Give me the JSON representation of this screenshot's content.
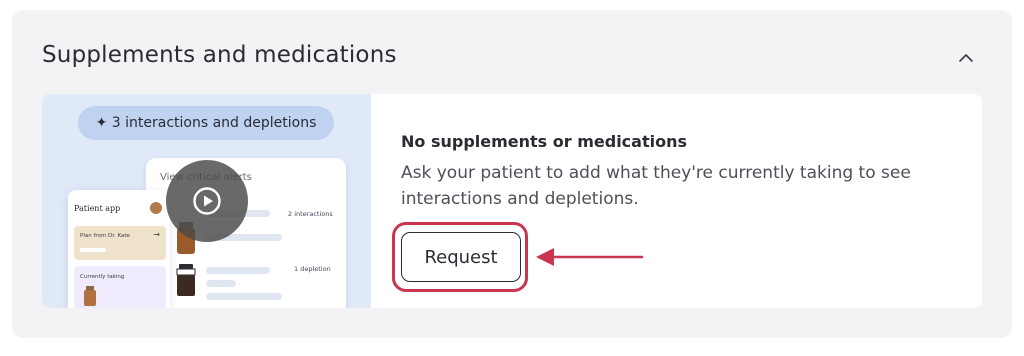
{
  "section": {
    "title": "Supplements and medications",
    "collapse_icon": "chevron-up-icon"
  },
  "preview": {
    "pill_label": "✦ 3 interactions and depletions",
    "alerts_title": "View critical alerts",
    "alert_rows": [
      {
        "count": "2 interactions"
      },
      {
        "count": "1 depletion"
      }
    ],
    "phone": {
      "title": "Patient app",
      "plan_label": "Plan from Dr. Kate",
      "plan_arrow": "→",
      "taking_label": "Currently taking"
    },
    "play_icon": "play-icon"
  },
  "empty_state": {
    "title": "No supplements or medications",
    "description": "Ask your patient to add what they're currently taking to see interactions and depletions.",
    "request_label": "Request"
  },
  "colors": {
    "highlight": "#c8364f",
    "card_bg": "#f3f3f5",
    "preview_bg": "#dfe9f8"
  }
}
